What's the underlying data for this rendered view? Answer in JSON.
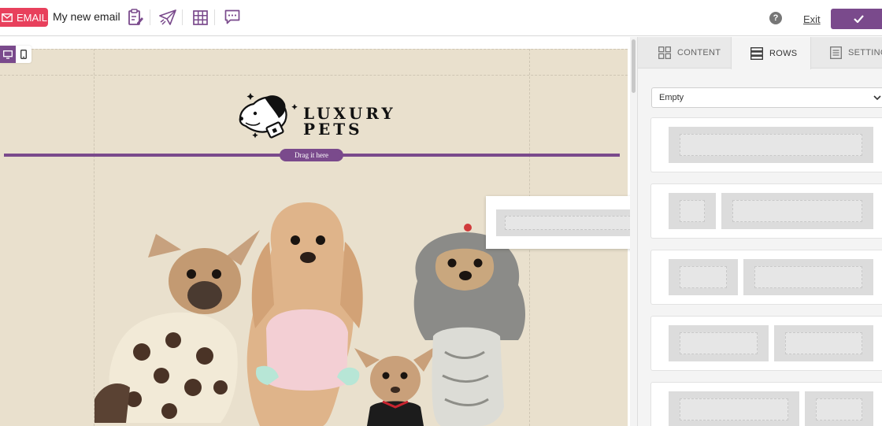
{
  "header": {
    "email_badge": "EMAIL",
    "doc_title": "My new email",
    "help_label": "?",
    "exit_label": "Exit",
    "tools": [
      "clipboard-edit-icon",
      "paper-plane-icon",
      "grid-icon",
      "comment-icon"
    ]
  },
  "canvas": {
    "drop_label": "Drag it here",
    "logo_text_line1": "LUXURY",
    "logo_text_line2": "PETS",
    "device_modes": [
      "desktop-icon",
      "mobile-icon"
    ],
    "active_device": "desktop"
  },
  "sidebar": {
    "tabs": [
      {
        "label": "CONTENT",
        "icon": "content-grid-icon"
      },
      {
        "label": "ROWS",
        "icon": "rows-icon",
        "active": true
      },
      {
        "label": "SETTINGS",
        "icon": "settings-doc-icon"
      }
    ],
    "select_value": "Empty"
  },
  "colors": {
    "accent": "#7a4a8c",
    "email_badge": "#e8405c",
    "canvas_bg": "#e9e0cd"
  }
}
